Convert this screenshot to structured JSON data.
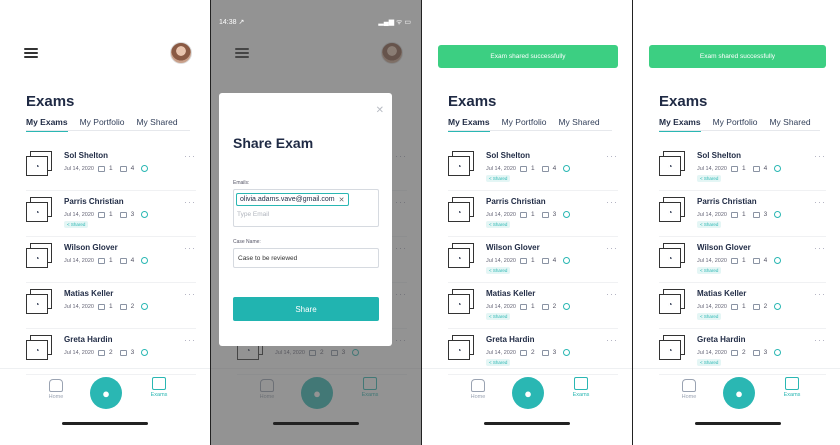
{
  "app": {
    "title": "Exams",
    "tabs": [
      "My Exams",
      "My Portfolio",
      "My Shared"
    ],
    "accent_color": "#2ab7b3",
    "toast_color": "#3ccf82"
  },
  "exams": [
    {
      "name": "Sol Shelton",
      "date": "Jul 14, 2020",
      "files": "1",
      "images": "4",
      "shared": "< Shared"
    },
    {
      "name": "Parris Christian",
      "date": "Jul 14, 2020",
      "files": "1",
      "images": "3",
      "shared": "< Shared"
    },
    {
      "name": "Wilson Glover",
      "date": "Jul 14, 2020",
      "files": "1",
      "images": "4",
      "shared": "< Shared"
    },
    {
      "name": "Matias Keller",
      "date": "Jul 14, 2020",
      "files": "1",
      "images": "2",
      "shared": "< Shared"
    },
    {
      "name": "Greta Hardin",
      "date": "Jul 14, 2020",
      "files": "2",
      "images": "3",
      "shared": "< Shared"
    }
  ],
  "nav": {
    "home": "Home",
    "exams": "Exams"
  },
  "toast": "Exam shared successfully",
  "status_bar": {
    "time": "14:38 ↗",
    "icons": "▂▄▆ ᯤ ▭"
  },
  "modal": {
    "title": "Share Exam",
    "email_label": "Emails:",
    "email_chip": "olivia.adams.vave@gmail.com",
    "email_placeholder": "Type Email",
    "case_label": "Case Name:",
    "case_value": "Case to be reviewed",
    "share_button": "Share"
  },
  "icons": {
    "menu": "hamburger-icon",
    "avatar": "user-avatar",
    "close": "close-icon",
    "camera": "camera-icon"
  }
}
